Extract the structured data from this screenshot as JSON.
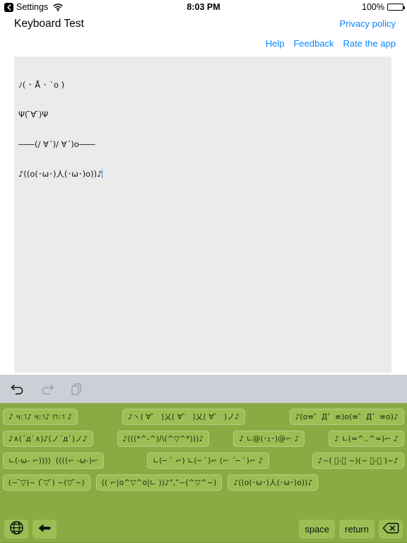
{
  "statusbar": {
    "back_app": "Settings",
    "wifi_icon": "wifi-icon",
    "time": "8:03 PM",
    "battery_percent": "100%",
    "battery_icon": "battery-full-icon"
  },
  "header": {
    "title": "Keyboard Test",
    "privacy_policy": "Privacy policy",
    "links": [
      {
        "label": "Help",
        "name": "help-link"
      },
      {
        "label": "Feedback",
        "name": "feedback-link"
      },
      {
        "label": "Rate the app",
        "name": "rate-the-app-link"
      }
    ]
  },
  "editor": {
    "lines": [
      "ﾉ( ･ Å ･ `o )",
      "Ψ( ̄∀ ̄)Ψ",
      "――(/ ∀´)/ ∀´)o――",
      "♪((o(･ω･)人(･ω･)o))♪"
    ],
    "caret_visible": true
  },
  "edit_toolbar": {
    "buttons": [
      {
        "name": "undo-button",
        "icon": "undo-icon",
        "enabled": true
      },
      {
        "name": "redo-button",
        "icon": "redo-icon",
        "enabled": false
      },
      {
        "name": "copy-button",
        "icon": "copy-icon",
        "enabled": false
      }
    ]
  },
  "keyboard": {
    "background_color": "#8aab44",
    "key_color": "#9bbf55",
    "rows": [
      [
        {
          "name": "suggestion-key",
          "text": "♪ ч:˥♪ ч:˦♪ ⊓:˦ ♪"
        },
        {
          "name": "suggestion-key",
          "text": "♪ヽ( ∀゜ )乂( ∀゜ )乂( ∀゜ )ノ♪"
        },
        {
          "name": "suggestion-key",
          "text": "♪(o≡゜Д゜≡)o(≡゜Д゜≡o)♪"
        }
      ],
      [
        {
          "name": "suggestion-key",
          "text": "♪∧(´д`∧)♪(ノ´д`)ノ♪"
        },
        {
          "name": "suggestion-key",
          "text": "♪(((*^-^)/\\(^▽^*)))♪"
        },
        {
          "name": "suggestion-key",
          "text": "♪ ∟@(･ｪ･)@⌐ ♪"
        },
        {
          "name": "suggestion-key",
          "text": "♪ ∟(=^‥^=)⌐ ♪"
        }
      ],
      [
        {
          "name": "suggestion-key",
          "text": "∟(-ω- ⌐))))  ((((⌐ -ω-)⌐"
        },
        {
          "name": "suggestion-key",
          "text": "∟(─ ` ⌐) ∟(─ `)⌐ (⌐ ´─ `)⌐ ♪"
        },
        {
          "name": "suggestion-key",
          "text": "♪~( ﾟ-ﾟ ~)(~ ﾟ-ﾟ )~♪"
        }
      ],
      [
        {
          "name": "suggestion-key",
          "text": "(~ ̄▽)~ ( ̄▽ ̄) ~(▽ ̄~)"
        },
        {
          "name": "suggestion-key",
          "text": "(( ⌐|o^▽^o|∟ ))♪\",\"~(^▽^~)"
        },
        {
          "name": "suggestion-key",
          "text": "♪((o(･ω･)人(･ω･)o))♪"
        }
      ]
    ],
    "bottom_keys": [
      {
        "name": "globe-key",
        "label": "",
        "icon": "globe-icon"
      },
      {
        "name": "back-arrow-key",
        "label": "",
        "icon": "back-arrow-icon"
      },
      {
        "name": "space-key",
        "label": "space",
        "icon": ""
      },
      {
        "name": "return-key",
        "label": "return",
        "icon": ""
      },
      {
        "name": "delete-key",
        "label": "",
        "icon": "backspace-icon"
      }
    ]
  }
}
